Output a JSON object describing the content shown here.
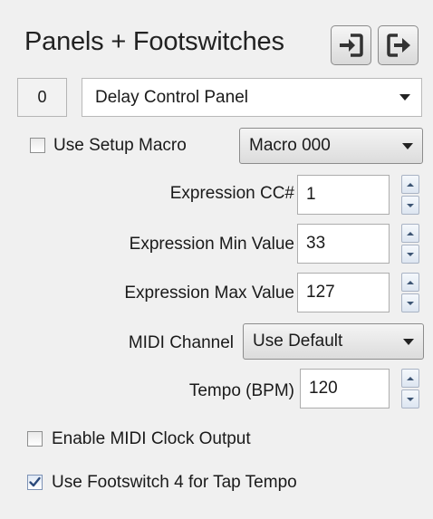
{
  "header": {
    "title": "Panels + Footswitches",
    "import_icon": "import-icon",
    "export_icon": "export-icon"
  },
  "panel": {
    "number": "0",
    "selected": "Delay Control Panel"
  },
  "setup_macro": {
    "label": "Use Setup Macro",
    "checked": false,
    "selected": "Macro 000"
  },
  "fields": {
    "expression_cc": {
      "label": "Expression CC#",
      "value": "1"
    },
    "expression_min": {
      "label": "Expression Min Value",
      "value": "33"
    },
    "expression_max": {
      "label": "Expression Max Value",
      "value": "127"
    },
    "midi_channel": {
      "label": "MIDI Channel",
      "selected": "Use Default"
    },
    "tempo": {
      "label": "Tempo (BPM)",
      "value": "120"
    }
  },
  "options": {
    "midi_clock": {
      "label": "Enable MIDI Clock Output",
      "checked": false
    },
    "tap_tempo": {
      "label": "Use Footswitch 4 for Tap Tempo",
      "checked": true
    }
  },
  "colors": {
    "background": "#f0f0f0",
    "checkmark": "#2b4a7c"
  }
}
